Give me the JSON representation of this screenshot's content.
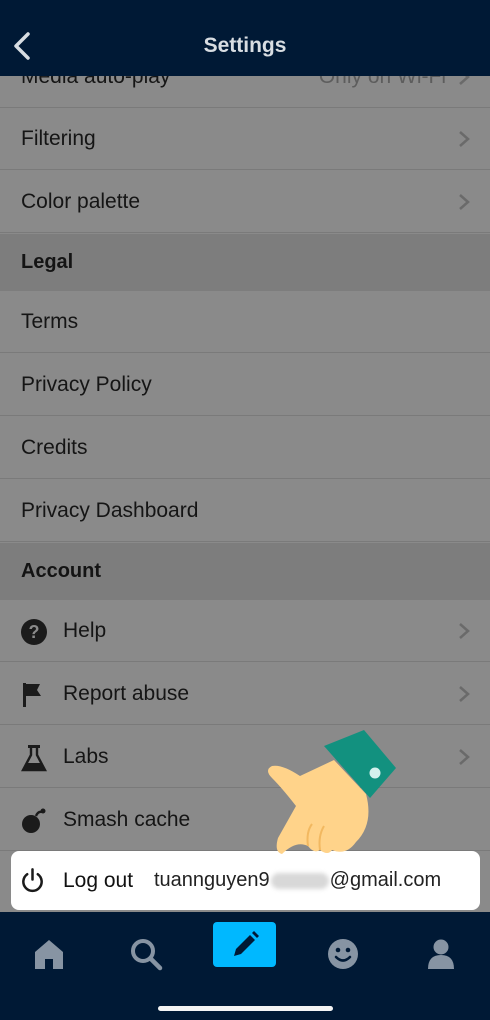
{
  "header": {
    "title": "Settings"
  },
  "rows_top": [
    {
      "label": "Media auto-play",
      "value": "Only on Wi-Fi"
    },
    {
      "label": "Filtering"
    },
    {
      "label": "Color palette"
    }
  ],
  "sections": {
    "legal": "Legal",
    "account": "Account"
  },
  "legal_items": [
    "Terms",
    "Privacy Policy",
    "Credits",
    "Privacy Dashboard"
  ],
  "account_items": [
    {
      "label": "Help",
      "icon": "help-icon"
    },
    {
      "label": "Report abuse",
      "icon": "flag-icon"
    },
    {
      "label": "Labs",
      "icon": "flask-icon"
    },
    {
      "label": "Smash cache",
      "icon": "bomb-icon"
    }
  ],
  "logout": {
    "label": "Log out",
    "email_start": "tuannguyen9",
    "email_end": "@gmail.com",
    "icon": "power-icon"
  },
  "nav": [
    "home-icon",
    "search-icon",
    "compose-icon",
    "emoji-icon",
    "account-icon"
  ],
  "colors": {
    "bar": "#001935",
    "accent": "#00b8ff",
    "list_bg": "#8a8a8a",
    "section_bg": "#7d7d7d"
  }
}
